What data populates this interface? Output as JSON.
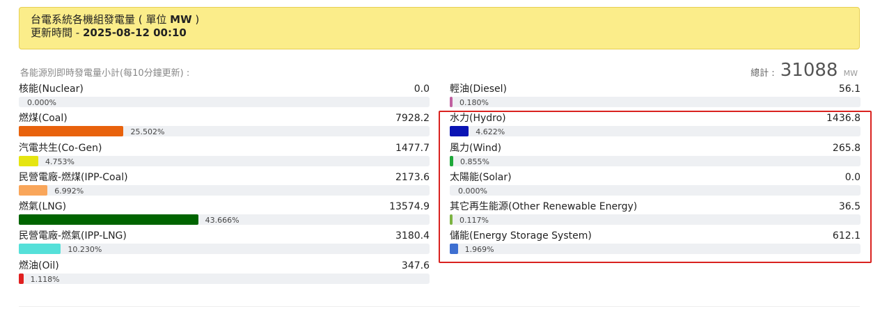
{
  "header": {
    "title_prefix": "台電系統各機組發電量 ( 單位 ",
    "title_unit": "MW",
    "title_suffix": " )",
    "updated_prefix": "更新時間 - ",
    "updated_time": "2025-08-12 00:10"
  },
  "subheading": "各能源別即時發電量小計(每10分鐘更新) :",
  "total": {
    "label": "總計 :",
    "value": "31088",
    "unit": "MW"
  },
  "left_items": [
    {
      "label": "核能(Nuclear)",
      "value": "0.0",
      "percent": "0.000%",
      "fraction": 0.0,
      "color": "#d8dbe0"
    },
    {
      "label": "燃煤(Coal)",
      "value": "7928.2",
      "percent": "25.502%",
      "fraction": 0.25502,
      "color": "#e8620c"
    },
    {
      "label": "汽電共生(Co-Gen)",
      "value": "1477.7",
      "percent": "4.753%",
      "fraction": 0.04753,
      "color": "#e5e511"
    },
    {
      "label": "民營電廠-燃煤(IPP-Coal)",
      "value": "2173.6",
      "percent": "6.992%",
      "fraction": 0.06992,
      "color": "#f9a65a"
    },
    {
      "label": "燃氣(LNG)",
      "value": "13574.9",
      "percent": "43.666%",
      "fraction": 0.43666,
      "color": "#006400"
    },
    {
      "label": "民營電廠-燃氣(IPP-LNG)",
      "value": "3180.4",
      "percent": "10.230%",
      "fraction": 0.1023,
      "color": "#55e0d9"
    },
    {
      "label": "燃油(Oil)",
      "value": "347.6",
      "percent": "1.118%",
      "fraction": 0.01118,
      "color": "#e02020"
    }
  ],
  "right_items": [
    {
      "label": "輕油(Diesel)",
      "value": "56.1",
      "percent": "0.180%",
      "fraction": 0.0018,
      "color": "#c060a0"
    },
    {
      "label": "水力(Hydro)",
      "value": "1436.8",
      "percent": "4.622%",
      "fraction": 0.04622,
      "color": "#0a14b4"
    },
    {
      "label": "風力(Wind)",
      "value": "265.8",
      "percent": "0.855%",
      "fraction": 0.00855,
      "color": "#1fa83a"
    },
    {
      "label": "太陽能(Solar)",
      "value": "0.0",
      "percent": "0.000%",
      "fraction": 0.0,
      "color": "#f5c000"
    },
    {
      "label": "其它再生能源(Other Renewable Energy)",
      "value": "36.5",
      "percent": "0.117%",
      "fraction": 0.00117,
      "color": "#7cb342"
    },
    {
      "label": "儲能(Energy Storage System)",
      "value": "612.1",
      "percent": "1.969%",
      "fraction": 0.01969,
      "color": "#3e6fd1"
    }
  ]
}
